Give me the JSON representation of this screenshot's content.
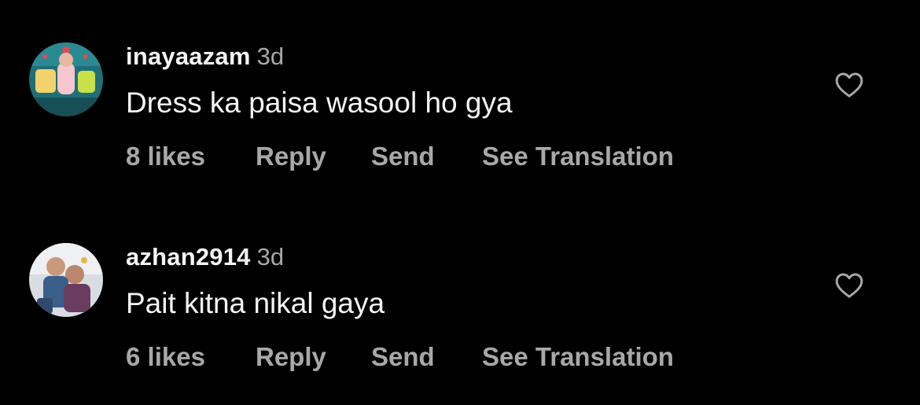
{
  "comments": [
    {
      "username": "inayaazam",
      "time": "3d",
      "text": "Dress ka paisa wasool ho gya",
      "likes": "8 likes",
      "reply": "Reply",
      "send": "Send",
      "translate": "See Translation",
      "like_icon": "heart-outline-icon"
    },
    {
      "username": "azhan2914",
      "time": "3d",
      "text": "Pait kitna nikal gaya",
      "likes": "6 likes",
      "reply": "Reply",
      "send": "Send",
      "translate": "See Translation",
      "like_icon": "heart-outline-icon"
    }
  ],
  "colors": {
    "background": "#000000",
    "primary_text": "#f5f5f5",
    "secondary_text": "#a8a8a8"
  }
}
